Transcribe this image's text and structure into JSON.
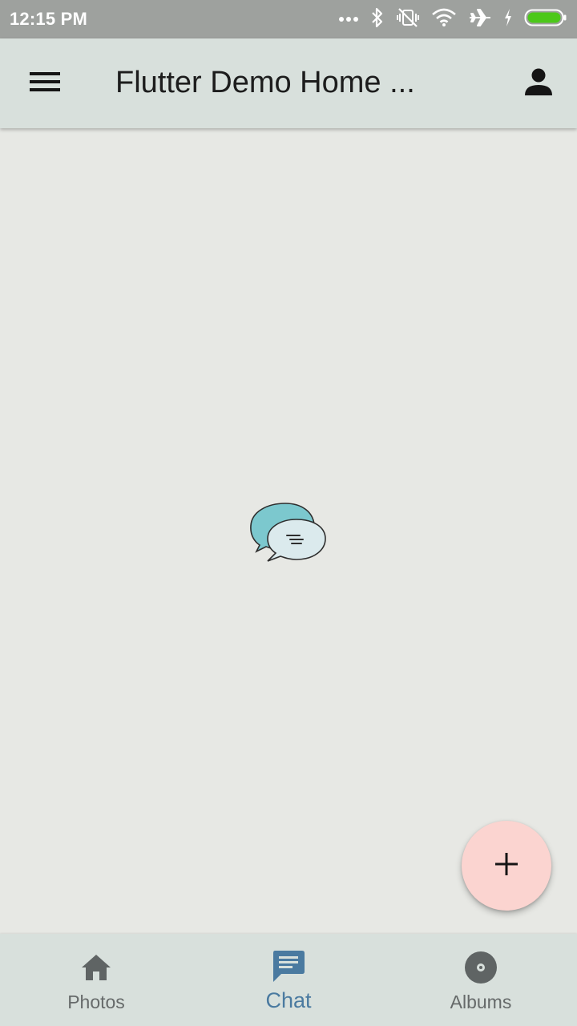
{
  "status_bar": {
    "time": "12:15 PM",
    "icons": [
      "more-dots-icon",
      "bluetooth-icon",
      "vibrate-off-icon",
      "wifi-icon",
      "airplane-icon",
      "charging-icon",
      "battery-icon"
    ]
  },
  "app_bar": {
    "title": "Flutter Demo Home ...",
    "menu_icon": "menu-icon",
    "account_icon": "account-icon"
  },
  "content": {
    "illustration": "chat-bubbles-icon"
  },
  "fab": {
    "icon": "add-icon",
    "color": "#fbd4d0"
  },
  "bottom_nav": {
    "items": [
      {
        "label": "Photos",
        "icon": "home-icon",
        "active": false
      },
      {
        "label": "Chat",
        "icon": "chat-icon",
        "active": true
      },
      {
        "label": "Albums",
        "icon": "album-icon",
        "active": false
      }
    ],
    "active_color": "#4a7aa0",
    "inactive_color": "#666a6a"
  },
  "colors": {
    "status_bar": "#9ea19e",
    "app_bar": "#d8e0dc",
    "background": "#e7e8e4",
    "battery": "#4cc81a"
  }
}
